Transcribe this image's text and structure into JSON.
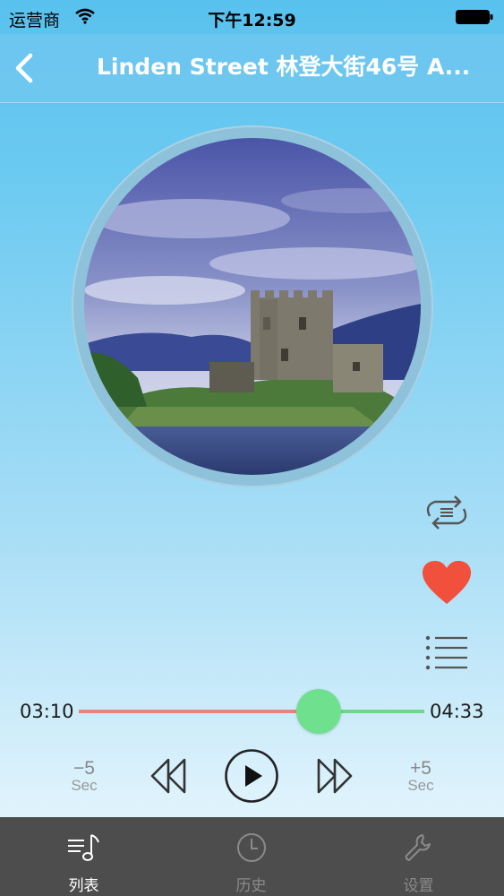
{
  "status_bar": {
    "carrier": "运营商",
    "time": "下午12:59"
  },
  "nav": {
    "title": "Linden Street 林登大街46号 A..."
  },
  "player": {
    "current_time": "03:10",
    "total_time": "04:33",
    "progress": 0.695,
    "liked": true,
    "seek_back": {
      "num": "−5",
      "unit": "Sec"
    },
    "seek_forward": {
      "num": "+5",
      "unit": "Sec"
    }
  },
  "tabs": [
    {
      "label": "列表",
      "icon": "music-list-icon",
      "active": true
    },
    {
      "label": "历史",
      "icon": "clock-icon",
      "active": false
    },
    {
      "label": "设置",
      "icon": "wrench-icon",
      "active": false
    }
  ],
  "colors": {
    "accent_green": "#6fe08e",
    "progress_played": "#e8857a",
    "heart": "#f0503c",
    "tab_bar": "#4d4d4d"
  }
}
